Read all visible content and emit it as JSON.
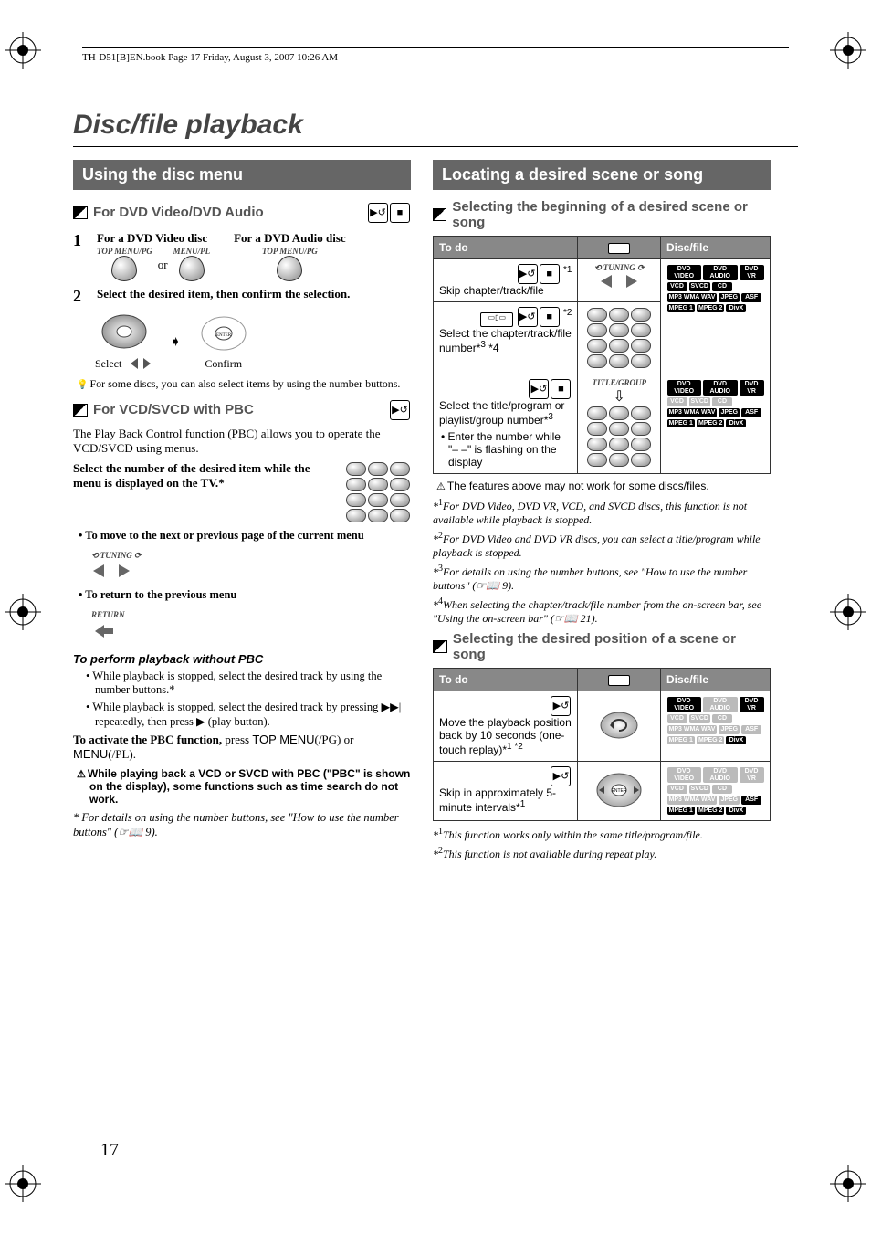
{
  "header": {
    "bookinfo": "TH-D51[B]EN.book  Page 17  Friday, August 3, 2007  10:26 AM"
  },
  "chapter_title": "Disc/file playback",
  "left": {
    "section_title": "Using the disc menu",
    "sub1": "For DVD Video/DVD Audio",
    "step1_a": "For a DVD Video disc",
    "step1_b": "For a DVD Audio disc",
    "knob_topmenu": "TOP MENU/PG",
    "knob_menu": "MENU/PL",
    "or": "or",
    "step2": "Select the desired item, then confirm the selection.",
    "select_label": "Select",
    "confirm_label": "Confirm",
    "note1": "For some discs, you can also select items by using the number buttons.",
    "sub2": "For VCD/SVCD with PBC",
    "pbc_text": "The Play Back Control function (PBC) allows you to operate the VCD/SVCD using menus.",
    "select_number": "Select the number of the desired item while the menu is displayed on the TV.",
    "select_number_sup": "*",
    "bullet_move": "To move to the next or previous page of the current menu",
    "tuning_label": "TUNING",
    "bullet_return": "To return to the previous menu",
    "return_label": "RETURN",
    "perform_title": "To perform playback without PBC",
    "perform_b1": "While playback is stopped, select the desired track by using the number buttons.*",
    "perform_b2_a": "While playback is stopped, select the desired track by pressing ",
    "perform_b2_b": " repeatedly, then press ",
    "perform_b2_c": " (play button).",
    "activate_a": "To activate the PBC function, ",
    "activate_b": "press ",
    "activate_c": "TOP MENU",
    "activate_d": "(/PG) or ",
    "activate_e": "MENU",
    "activate_f": "(/PL).",
    "caution": "While playing back a VCD or SVCD with PBC (\"PBC\" is shown on the display), some functions such as time search do not work.",
    "foot_a": "*  For details on using the number buttons, see \"How to use the number buttons\" (",
    "foot_b": "  9)."
  },
  "right": {
    "section_title": "Locating a desired scene or song",
    "sub1": "Selecting the beginning of a desired scene or song",
    "table1": {
      "h1": "To do",
      "h3": "Disc/file",
      "r1_todo_a": "Skip chapter/track/file",
      "r1_sup": "*1",
      "r2_todo": "Select the chapter/track/file number*",
      "r2_sup_a": "3",
      "r2_sup_b": " *4",
      "r2_top_sup": "*2",
      "r3_todo_a": "Select the title/program or playlist/group number*",
      "r3_sup": "3",
      "r3_bullet": "Enter the number while \"– –\" is flashing on the display"
    },
    "note_after_t1": "The features above may not work for some discs/files.",
    "fn1": "For DVD Video, DVD VR, VCD, and SVCD discs, this function is not available while playback is stopped.",
    "fn2": "For DVD Video and DVD VR discs, you can select a title/program while playback is stopped.",
    "fn3_a": "For details on using the number buttons, see \"How to use the number buttons\" (",
    "fn3_b": "  9).",
    "fn4_a": "When selecting the chapter/track/file number from the on-screen bar, see \"Using the on-screen bar\" (",
    "fn4_b": "  21).",
    "sub2": "Selecting the desired position of a scene or song",
    "table2": {
      "h1": "To do",
      "h3": "Disc/file",
      "r1_todo": "Move the playback position back by 10 seconds (one-touch replay)*",
      "r1_sup": "1 *2",
      "r2_todo": "Skip in approximately 5-minute intervals*",
      "r2_sup": "1"
    },
    "fn_b1": "This function works only within the same title/program/file.",
    "fn_b2": "This function is not available during repeat play.",
    "badges": {
      "dvd_video": "DVD VIDEO",
      "dvd_audio": "DVD AUDIO",
      "dvd_vr": "DVD VR",
      "vcd": "VCD",
      "svcd": "SVCD",
      "cd": "CD",
      "mp3": "MP3 WMA WAV",
      "jpeg": "JPEG",
      "asf": "ASF",
      "mpeg1": "MPEG 1",
      "mpeg2": "MPEG 2",
      "divx": "DivX"
    }
  },
  "page_number": "17"
}
